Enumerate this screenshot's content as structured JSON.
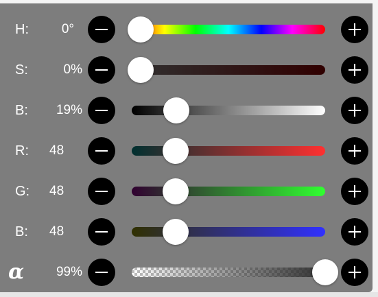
{
  "sliders": [
    {
      "id": "hue",
      "label": "H:",
      "value_text": "0°",
      "value": 0,
      "min": 0,
      "max": 360
    },
    {
      "id": "saturation",
      "label": "S:",
      "value_text": "0%",
      "value": 0,
      "min": 0,
      "max": 100
    },
    {
      "id": "brightness",
      "label": "B:",
      "value_text": "19%",
      "value": 19,
      "min": 0,
      "max": 100
    },
    {
      "id": "red",
      "label": "R:",
      "value_text": "48",
      "value": 48,
      "min": 0,
      "max": 255
    },
    {
      "id": "green",
      "label": "G:",
      "value_text": "48",
      "value": 48,
      "min": 0,
      "max": 255
    },
    {
      "id": "blue",
      "label": "B:",
      "value_text": "48",
      "value": 48,
      "min": 0,
      "max": 255
    },
    {
      "id": "alpha",
      "label": "α",
      "value_text": "99%",
      "value": 99,
      "min": 0,
      "max": 100
    }
  ],
  "colors": {
    "panel": "#7d7d7d",
    "button": "#000000",
    "knob": "#ffffff",
    "current_color": "#303030"
  },
  "icons": {
    "decrement": "minus-icon",
    "increment": "plus-icon"
  }
}
